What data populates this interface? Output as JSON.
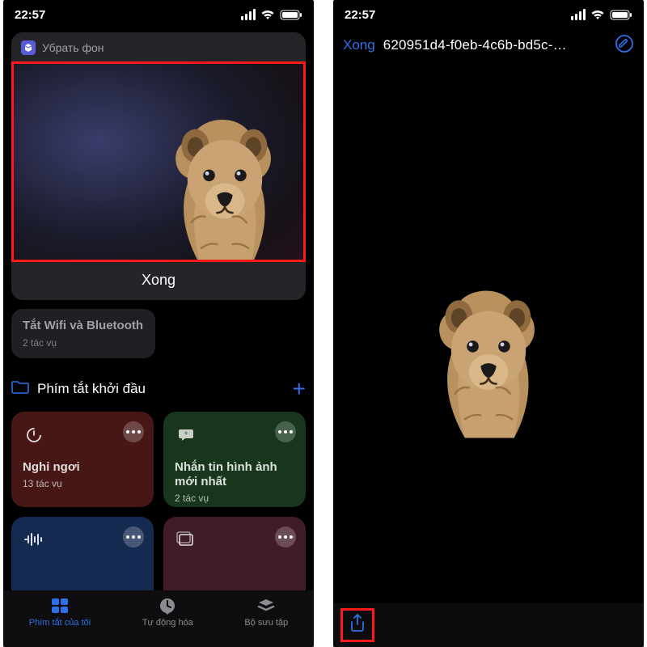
{
  "status": {
    "time": "22:57"
  },
  "left": {
    "card": {
      "app_label": "Убрать фон",
      "done": "Xong"
    },
    "wifi_chip": {
      "title": "Tắt Wifi và Bluetooth",
      "sub": "2 tác vụ"
    },
    "section": {
      "title": "Phím tắt khởi đầu"
    },
    "tiles": {
      "rest": {
        "label": "Nghỉ ngơi",
        "sub": "13 tác vụ"
      },
      "message": {
        "label": "Nhắn tin hình ảnh mới nhất",
        "sub": "2 tác vụ"
      }
    },
    "tabs": {
      "mine": "Phím tắt của tôi",
      "auto": "Tự động hóa",
      "gallery": "Bộ sưu tập"
    }
  },
  "right": {
    "nav": {
      "done": "Xong",
      "filename": "620951d4-f0eb-4c6b-bd5c-…"
    }
  }
}
